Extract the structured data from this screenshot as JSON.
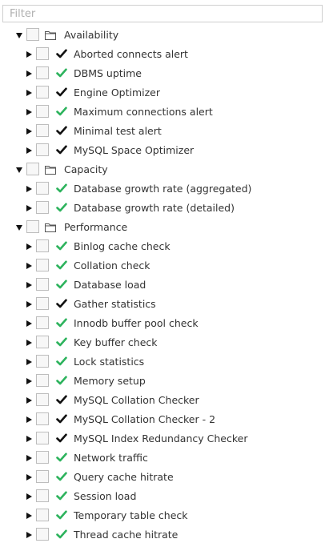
{
  "filter": {
    "placeholder": "Filter",
    "value": ""
  },
  "colors": {
    "check_green": "#2db35d",
    "check_black": "#111111"
  },
  "groups": [
    {
      "label": "Availability",
      "icon": "folder-icon",
      "expanded": true,
      "items": [
        {
          "label": "Aborted connects alert",
          "check": "black"
        },
        {
          "label": "DBMS uptime",
          "check": "green"
        },
        {
          "label": "Engine Optimizer",
          "check": "black"
        },
        {
          "label": "Maximum connections alert",
          "check": "green"
        },
        {
          "label": "Minimal test alert",
          "check": "black"
        },
        {
          "label": "MySQL Space Optimizer",
          "check": "black"
        }
      ]
    },
    {
      "label": "Capacity",
      "icon": "folder-icon",
      "expanded": true,
      "items": [
        {
          "label": "Database growth rate (aggregated)",
          "check": "green"
        },
        {
          "label": "Database growth rate (detailed)",
          "check": "green"
        }
      ]
    },
    {
      "label": "Performance",
      "icon": "folder-icon",
      "expanded": true,
      "items": [
        {
          "label": "Binlog cache check",
          "check": "green"
        },
        {
          "label": "Collation check",
          "check": "green"
        },
        {
          "label": "Database load",
          "check": "green"
        },
        {
          "label": "Gather statistics",
          "check": "black"
        },
        {
          "label": "Innodb buffer pool check",
          "check": "green"
        },
        {
          "label": "Key buffer check",
          "check": "green"
        },
        {
          "label": "Lock statistics",
          "check": "green"
        },
        {
          "label": "Memory setup",
          "check": "green"
        },
        {
          "label": "MySQL Collation Checker",
          "check": "black"
        },
        {
          "label": "MySQL Collation Checker - 2",
          "check": "black"
        },
        {
          "label": "MySQL Index Redundancy Checker",
          "check": "black"
        },
        {
          "label": "Network traffic",
          "check": "green"
        },
        {
          "label": "Query cache hitrate",
          "check": "green"
        },
        {
          "label": "Session load",
          "check": "green"
        },
        {
          "label": "Temporary table check",
          "check": "green"
        },
        {
          "label": "Thread cache hitrate",
          "check": "green"
        }
      ]
    }
  ]
}
